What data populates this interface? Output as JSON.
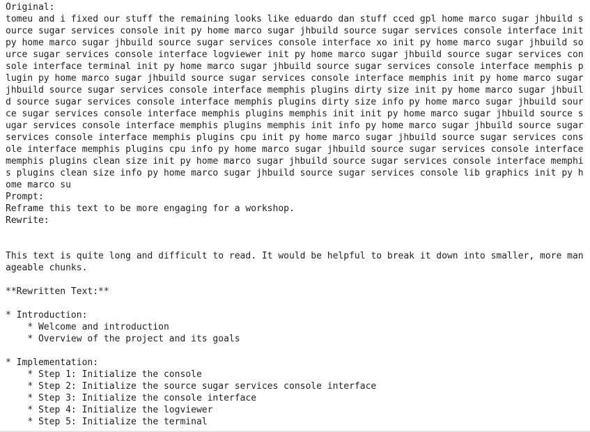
{
  "document": {
    "lines": [
      "Original:",
      "tomeu and i fixed our stuff the remaining looks like eduardo dan stuff cced gpl home marco sugar jhbuild source sugar services console init py home marco sugar jhbuild source sugar services console interface init py home marco sugar jhbuild source sugar services console interface xo init py home marco sugar jhbuild source sugar services console interface logviewer init py home marco sugar jhbuild source sugar services console interface terminal init py home marco sugar jhbuild source sugar services console interface memphis plugin py home marco sugar jhbuild source sugar services console interface memphis init py home marco sugar jhbuild source sugar services console interface memphis plugins dirty size init py home marco sugar jhbuild source sugar services console interface memphis plugins dirty size info py home marco sugar jhbuild source sugar services console interface memphis plugins memphis init init py home marco sugar jhbuild source sugar services console interface memphis plugins memphis init info py home marco sugar jhbuild source sugar services console interface memphis plugins cpu init py home marco sugar jhbuild source sugar services console interface memphis plugins cpu info py home marco sugar jhbuild source sugar services console interface memphis plugins clean size init py home marco sugar jhbuild source sugar services console interface memphis plugins clean size info py home marco sugar jhbuild source sugar services console lib graphics init py home marco su",
      "Prompt:",
      "Reframe this text to be more engaging for a workshop.",
      "Rewrite:",
      "",
      "",
      "This text is quite long and difficult to read. It would be helpful to break it down into smaller, more manageable chunks.",
      "",
      "**Rewritten Text:**",
      "",
      "* Introduction:",
      "    * Welcome and introduction",
      "    * Overview of the project and its goals",
      "",
      "* Implementation:",
      "    * Step 1: Initialize the console",
      "    * Step 2: Initialize the source sugar services console interface",
      "    * Step 3: Initialize the console interface",
      "    * Step 4: Initialize the logviewer",
      "    * Step 5: Initialize the terminal"
    ]
  }
}
